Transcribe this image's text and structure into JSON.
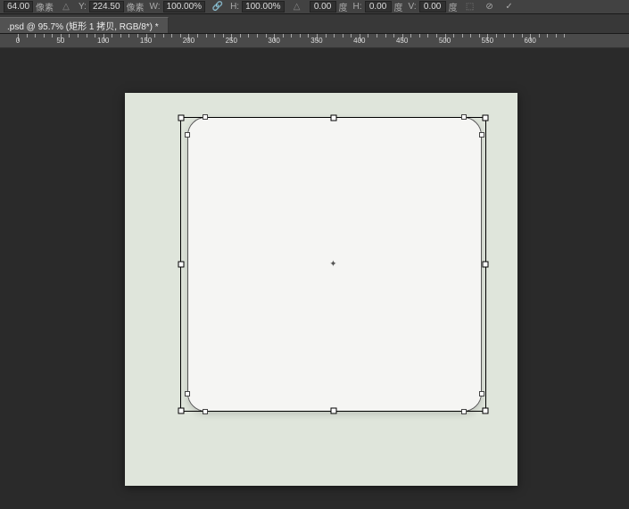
{
  "options_bar": {
    "x_value": "64.00",
    "x_unit": "像素",
    "y_label": "Y:",
    "y_value": "224.50",
    "y_unit": "像素",
    "w_label": "W:",
    "w_value": "100.00%",
    "h_label": "H:",
    "h_value": "100.00%",
    "angle_value": "0.00",
    "angle_unit": "度",
    "sh_label": "H:",
    "sh_value": "0.00",
    "sh_unit": "度",
    "sv_label": "V:",
    "sv_value": "0.00",
    "sv_unit": "度"
  },
  "document_tab": {
    "title": ".psd @ 95.7% (矩形 1 拷贝, RGB/8*) *"
  },
  "ruler": {
    "ticks": [
      0,
      50,
      100,
      150,
      200,
      250,
      300,
      350,
      400,
      450,
      500,
      550,
      600
    ]
  }
}
